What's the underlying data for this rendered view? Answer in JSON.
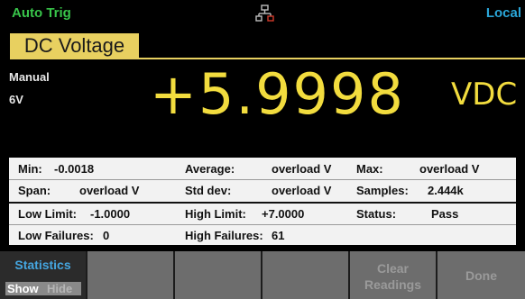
{
  "status_bar": {
    "trigger": "Auto Trig",
    "remote": "Local",
    "network_icon": "network-lan-icon"
  },
  "function": "DC Voltage",
  "range": {
    "mode": "Manual",
    "value": "6V"
  },
  "reading": {
    "value": "+5.9998",
    "unit": "VDC"
  },
  "stats": {
    "min_label": "Min:",
    "min_value": "-0.0018",
    "average_label": "Average:",
    "average_value": "overload V",
    "max_label": "Max:",
    "max_value": "overload V",
    "span_label": "Span:",
    "span_value": "overload V",
    "stddev_label": "Std dev:",
    "stddev_value": "overload V",
    "samples_label": "Samples:",
    "samples_value": "2.444k",
    "low_limit_label": "Low Limit:",
    "low_limit_value": "-1.0000",
    "high_limit_label": "High Limit:",
    "high_limit_value": "+7.0000",
    "status_label": "Status:",
    "status_value": "Pass",
    "low_failures_label": "Low Failures:",
    "low_failures_value": "0",
    "high_failures_label": "High Failures:",
    "high_failures_value": "61"
  },
  "softkeys": {
    "statistics_title": "Statistics",
    "show": "Show",
    "hide": "Hide",
    "clear_line1": "Clear",
    "clear_line2": "Readings",
    "done": "Done"
  },
  "colors": {
    "reading": "#f2dc3e",
    "function_tab": "#e8d060",
    "trigger": "#38c44a",
    "local": "#2aa6d8",
    "statistics": "#45a6e0"
  }
}
